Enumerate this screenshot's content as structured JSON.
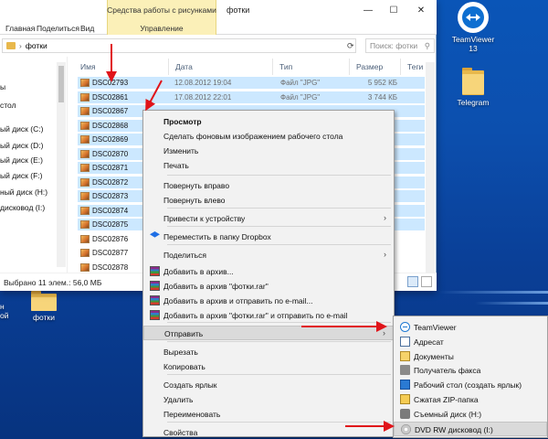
{
  "window": {
    "title": "фотки",
    "tabs": [
      "Главная",
      "Поделиться",
      "Вид"
    ],
    "context_tab_group": "Средства работы с рисунками",
    "context_tab": "Управление",
    "min": "—",
    "max": "☐",
    "close": "✕"
  },
  "address": {
    "path": "фотки",
    "search_placeholder": "Поиск: фотки"
  },
  "nav": {
    "items": [
      "",
      "ы",
      "стол",
      "ый диск (C:)",
      "ый диск (D:)",
      "ый диск (E:)",
      "ый диск (F:)",
      "ный диск (H:)",
      "дисковод (I:)"
    ]
  },
  "columns": {
    "name": "Имя",
    "date": "Дата",
    "type": "Тип",
    "size": "Размер",
    "tags": "Теги"
  },
  "files": [
    {
      "name": "DSC02793",
      "date": "12.08.2012 19:04",
      "type": "Файл \"JPG\"",
      "size": "5 952 КБ"
    },
    {
      "name": "DSC02861",
      "date": "17.08.2012 22:01",
      "type": "Файл \"JPG\"",
      "size": "3 744 КБ"
    },
    {
      "name": "DSC02867",
      "date": "",
      "type": "",
      "size": ""
    },
    {
      "name": "DSC02868",
      "date": "",
      "type": "",
      "size": ""
    },
    {
      "name": "DSC02869",
      "date": "",
      "type": "",
      "size": ""
    },
    {
      "name": "DSC02870",
      "date": "",
      "type": "",
      "size": ""
    },
    {
      "name": "DSC02871",
      "date": "",
      "type": "",
      "size": ""
    },
    {
      "name": "DSC02872",
      "date": "",
      "type": "",
      "size": ""
    },
    {
      "name": "DSC02873",
      "date": "",
      "type": "",
      "size": ""
    },
    {
      "name": "DSC02874",
      "date": "",
      "type": "",
      "size": ""
    },
    {
      "name": "DSC02875",
      "date": "",
      "type": "",
      "size": ""
    },
    {
      "name": "DSC02876",
      "date": "",
      "type": "",
      "size": ""
    },
    {
      "name": "DSC02877",
      "date": "",
      "type": "",
      "size": ""
    },
    {
      "name": "DSC02878",
      "date": "",
      "type": "",
      "size": ""
    }
  ],
  "status": {
    "text": "Выбрано 11 элем.: 56,0 МБ"
  },
  "context_menu": {
    "items": [
      "Просмотр",
      "Сделать фоновым изображением рабочего стола",
      "Изменить",
      "Печать",
      "Повернуть вправо",
      "Повернуть влево",
      "Привести к устройству",
      "Переместить в папку Dropbox",
      "Поделиться",
      "Добавить в архив...",
      "Добавить в архив \"фотки.rar\"",
      "Добавить в архив и отправить по e-mail...",
      "Добавить в архив \"фотки.rar\" и отправить по e-mail",
      "Отправить",
      "Вырезать",
      "Копировать",
      "Создать ярлык",
      "Удалить",
      "Переименовать",
      "Свойства"
    ]
  },
  "sendto_menu": {
    "items": [
      "TeamViewer",
      "Адресат",
      "Документы",
      "Получатель факса",
      "Рабочий стол (создать ярлык)",
      "Сжатая ZIP-папка",
      "Съемный диск (H:)",
      "DVD RW дисковод (I:)"
    ]
  },
  "desktop": {
    "teamviewer_label": "TeamViewer 13",
    "telegram_label": "Telegram",
    "fotki_label": "фотки",
    "left_label_1": "н",
    "left_label_2": "ой"
  },
  "colors": {
    "selection": "#cce8ff",
    "arrow": "#e0141a",
    "desktop": "#0c4fae"
  }
}
